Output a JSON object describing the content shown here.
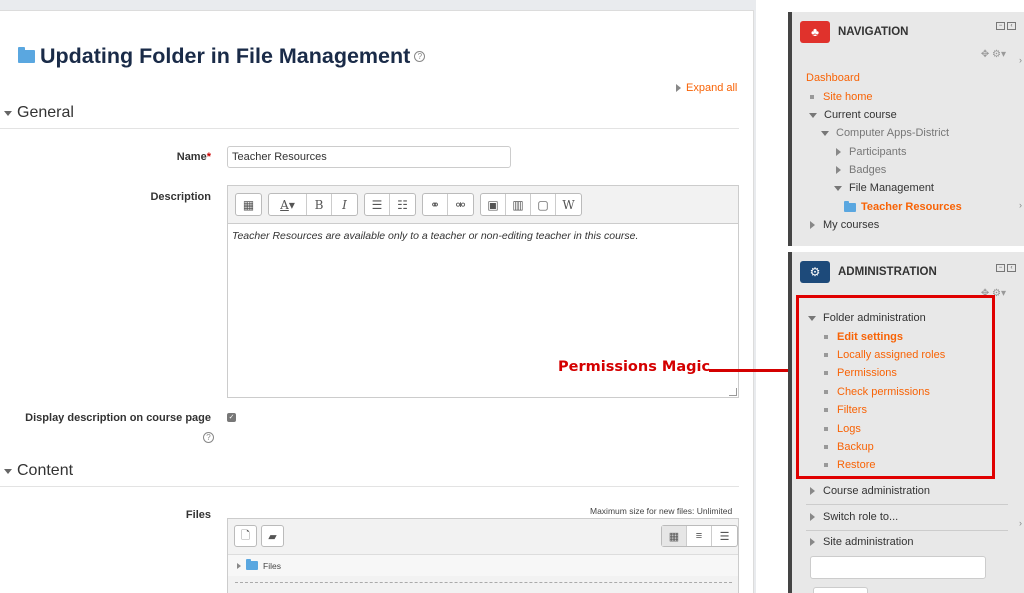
{
  "page": {
    "title": "Updating Folder in File Management",
    "expand_all": "Expand all"
  },
  "general": {
    "header": "General",
    "name_label": "Name",
    "required_mark": "*",
    "name_value": "Teacher Resources",
    "description_label": "Description",
    "description_text": "Teacher Resources are available only to a teacher or non-editing teacher in this course.",
    "display_desc_label": "Display description on course page",
    "display_desc_checked": true
  },
  "content": {
    "header": "Content",
    "files_label": "Files",
    "max_size": "Maximum size for new files: Unlimited",
    "files_path": "Files"
  },
  "annotation": {
    "text": "Permissions Magic",
    "color": "#d40000"
  },
  "navigation": {
    "title": "NAVIGATION",
    "icon_color": "#e0322c",
    "dashboard": "Dashboard",
    "site_home": "Site home",
    "current_course": "Current course",
    "course_name": "Computer Apps-District",
    "participants": "Participants",
    "badges": "Badges",
    "file_management": "File Management",
    "teacher_resources": "Teacher Resources",
    "my_courses": "My courses"
  },
  "administration": {
    "title": "ADMINISTRATION",
    "icon_color": "#1d4a7a",
    "folder_admin": "Folder administration",
    "items": [
      "Edit settings",
      "Locally assigned roles",
      "Permissions",
      "Check permissions",
      "Filters",
      "Logs",
      "Backup",
      "Restore"
    ],
    "course_admin": "Course administration",
    "switch_role": "Switch role to...",
    "site_admin": "Site administration"
  },
  "colors": {
    "link": "#f86306",
    "title": "#1a2b48"
  }
}
